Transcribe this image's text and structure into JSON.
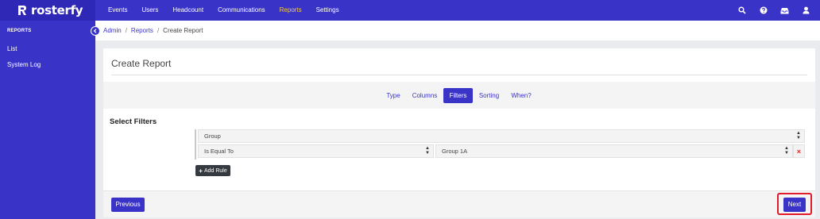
{
  "app": {
    "name": "rosterfy"
  },
  "topnav": {
    "items": [
      {
        "label": "Events",
        "active": false
      },
      {
        "label": "Users",
        "active": false
      },
      {
        "label": "Headcount",
        "active": false
      },
      {
        "label": "Communications",
        "active": false
      },
      {
        "label": "Reports",
        "active": true
      },
      {
        "label": "Settings",
        "active": false
      }
    ],
    "icons": [
      "search-icon",
      "help-icon",
      "inbox-icon",
      "user-icon"
    ]
  },
  "sidebar": {
    "heading": "REPORTS",
    "items": [
      {
        "label": "List"
      },
      {
        "label": "System Log"
      }
    ]
  },
  "breadcrumb": {
    "items": [
      "Admin",
      "Reports",
      "Create Report"
    ],
    "separator": "/"
  },
  "card": {
    "title": "Create Report"
  },
  "steps": {
    "items": [
      {
        "label": "Type",
        "active": false
      },
      {
        "label": "Columns",
        "active": false
      },
      {
        "label": "Filters",
        "active": true
      },
      {
        "label": "Sorting",
        "active": false
      },
      {
        "label": "When?",
        "active": false
      }
    ]
  },
  "filters": {
    "heading": "Select Filters",
    "field_select": "Group",
    "operator_select": "Is Equal To",
    "value_select": "Group 1A",
    "add_rule_label": "Add Rule",
    "remove_symbol": "×"
  },
  "footer": {
    "previous_label": "Previous",
    "next_label": "Next"
  },
  "colors": {
    "brand": "#3a33c7",
    "active_nav": "#f2c84b",
    "highlight": "#e21b2a",
    "remove": "#e02424"
  }
}
